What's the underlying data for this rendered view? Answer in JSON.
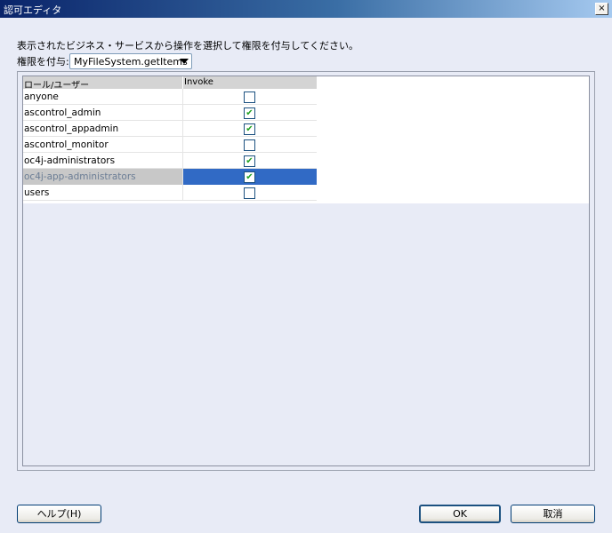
{
  "window": {
    "title": "認可エディタ",
    "close_glyph": "×"
  },
  "instruction": "表示されたビジネス・サービスから操作を選択して権限を付与してください。",
  "grant": {
    "label": "権限を付与:",
    "selected": "MyFileSystem.getItems"
  },
  "table": {
    "columns": [
      "ロール/ユーザー",
      "Invoke"
    ],
    "rows": [
      {
        "name": "anyone",
        "invoke": false
      },
      {
        "name": "ascontrol_admin",
        "invoke": true
      },
      {
        "name": "ascontrol_appadmin",
        "invoke": true
      },
      {
        "name": "ascontrol_monitor",
        "invoke": false
      },
      {
        "name": "oc4j-administrators",
        "invoke": true
      },
      {
        "name": "oc4j-app-administrators",
        "invoke": true,
        "selected": true
      },
      {
        "name": "users",
        "invoke": false
      }
    ]
  },
  "buttons": {
    "help": "ヘルプ(H)",
    "ok": "OK",
    "cancel": "取消"
  },
  "colors": {
    "selection": "#316ac5",
    "check": "#21a121",
    "title_bar": "#0a246a"
  }
}
